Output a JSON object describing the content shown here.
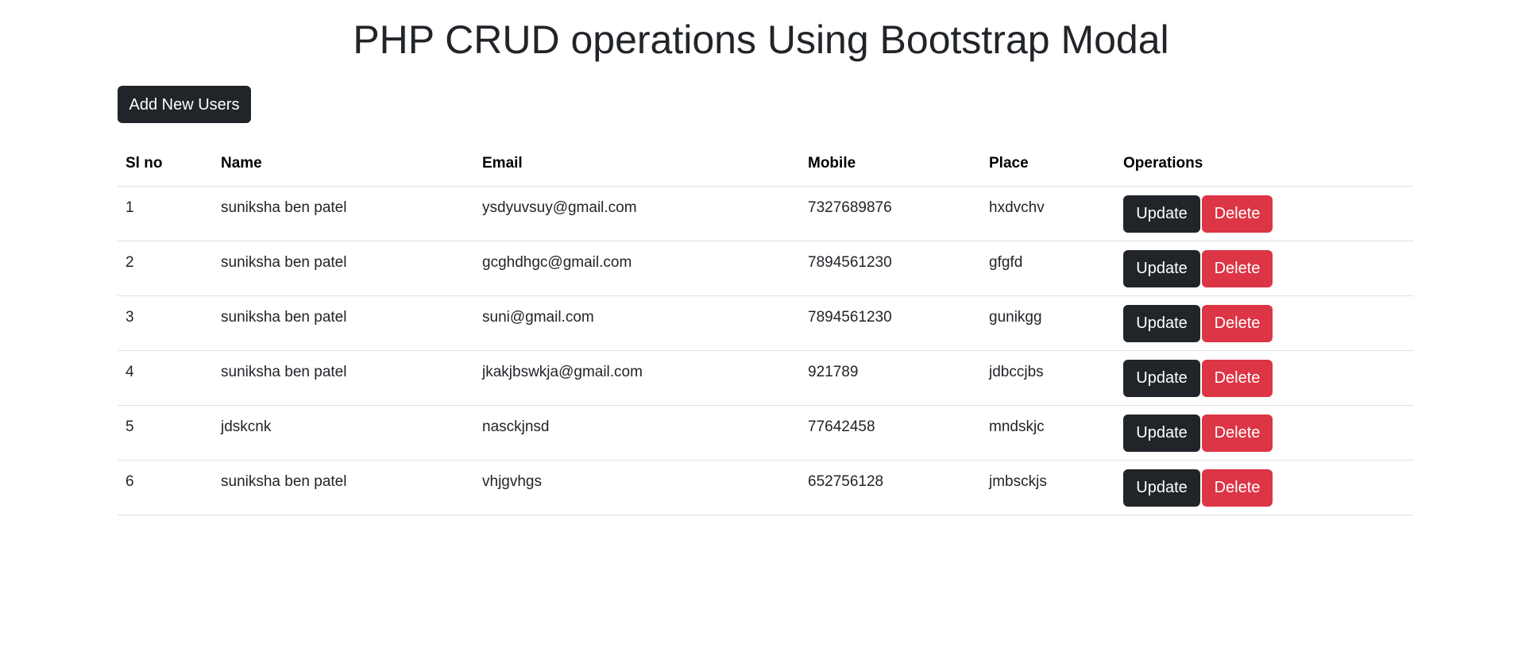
{
  "page": {
    "title": "PHP CRUD operations Using Bootstrap Modal"
  },
  "toolbar": {
    "add_label": "Add New Users"
  },
  "table": {
    "headers": [
      "Sl no",
      "Name",
      "Email",
      "Mobile",
      "Place",
      "Operations"
    ],
    "rows": [
      {
        "sl": "1",
        "name": "suniksha ben patel",
        "email": "ysdyuvsuy@gmail.com",
        "mobile": "7327689876",
        "place": "hxdvchv"
      },
      {
        "sl": "2",
        "name": "suniksha ben patel",
        "email": "gcghdhgc@gmail.com",
        "mobile": "7894561230",
        "place": "gfgfd"
      },
      {
        "sl": "3",
        "name": "suniksha ben patel",
        "email": "suni@gmail.com",
        "mobile": "7894561230",
        "place": "gunikgg"
      },
      {
        "sl": "4",
        "name": "suniksha ben patel",
        "email": "jkakjbswkja@gmail.com",
        "mobile": "921789",
        "place": "jdbccjbs"
      },
      {
        "sl": "5",
        "name": "jdskcnk",
        "email": "nasckjnsd",
        "mobile": "77642458",
        "place": "mndskjc"
      },
      {
        "sl": "6",
        "name": "suniksha ben patel",
        "email": "vhjgvhgs",
        "mobile": "652756128",
        "place": "jmbsckjs"
      }
    ],
    "update_label": "Update",
    "delete_label": "Delete"
  },
  "colors": {
    "dark": "#212529",
    "danger": "#dc3545",
    "border": "#dee2e6"
  }
}
